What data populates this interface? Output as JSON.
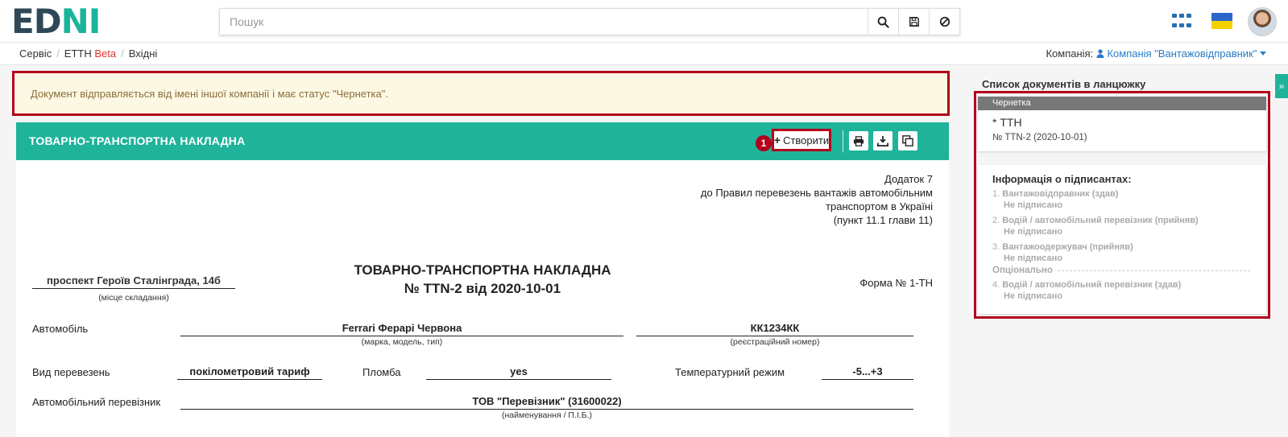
{
  "header": {
    "logo_left": "ED",
    "logo_right": "NI",
    "search_placeholder": "Пошук"
  },
  "breadcrumb": {
    "items": [
      "Сервіс",
      "ЕТТН",
      "Вхідні"
    ],
    "beta": "Beta"
  },
  "company": {
    "label": "Компанія:",
    "value": "Компанія \"Вантажовідправник\""
  },
  "alert": {
    "text": "Документ відправляється від імені іншої компанії і має статус \"Чернетка\"."
  },
  "doc": {
    "header_title": "ТОВАРНО-ТРАНСПОРТНА НАКЛАДНА",
    "step_badge": "1",
    "create_label": "Створити",
    "appendix": {
      "line1": "Додаток 7",
      "line2": "до Правил перевезень вантажів автомобільним",
      "line3": "транспортом в Україні",
      "line4": "(пункт 11.1 глави 11)"
    },
    "title": "ТОВАРНО-ТРАНСПОРТНА НАКЛАДНА",
    "number_line": "№ TTN-2 від 2020-10-01",
    "place_value": "проспект Героїв Сталінграда, 14б",
    "place_caption": "(місце складання)",
    "form_no": "Форма № 1-ТН",
    "car_label": "Автомобіль",
    "car_value": "Ferrari Ферарі Червона",
    "car_caption": "(марка, модель, тип)",
    "reg_value": "КК1234КК",
    "reg_caption": "(реєстраційний номер)",
    "transport_type_label": "Вид перевезень",
    "transport_type_value": "покілометровий тариф",
    "seal_label": "Пломба",
    "seal_value": "yes",
    "temp_label": "Температурний режим",
    "temp_value": "-5...+3",
    "carrier_label": "Автомобільний перевізник",
    "carrier_value": "ТОВ \"Перевізник\" (31600022)",
    "carrier_caption": "(найменування / П.І.Б.)"
  },
  "sidebar": {
    "title": "Список документів в ланцюжку",
    "doc_card": {
      "status": "Чернетка",
      "name": "* ТТН",
      "number": "№ TTN-2 (2020-10-01)"
    },
    "signers_title": "Інформація о підписантах:",
    "signers": [
      {
        "idx": "1.",
        "role": "Вантажовідправник (здав)",
        "state": "Не підписано"
      },
      {
        "idx": "2.",
        "role": "Водій / автомобільний перевізник (прийняв)",
        "state": "Не підписано"
      },
      {
        "idx": "3.",
        "role": "Вантажоодержувач (прийняв)",
        "state": "Не підписано"
      },
      {
        "idx": "4.",
        "role": "Водій / автомобільний перевізник (здав)",
        "state": "Не підписано"
      }
    ],
    "optional_label": "Опціонально",
    "toggle_label": "»"
  },
  "colors": {
    "accent": "#1fb39a",
    "highlight": "#b3001b",
    "link": "#2a7bc8",
    "beta": "#e5322d"
  }
}
